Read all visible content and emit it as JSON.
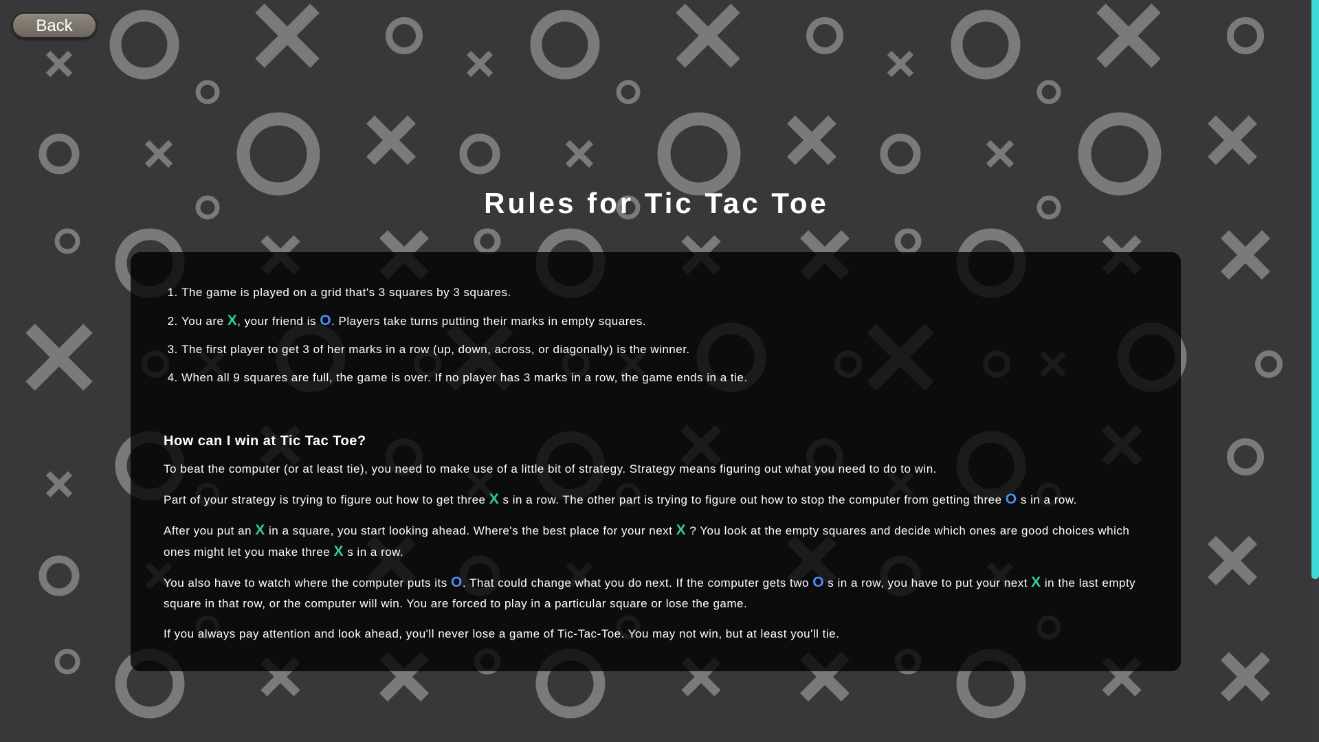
{
  "back_button": {
    "label": "Back"
  },
  "background": {
    "pattern_icons": [
      "x-mark-icon",
      "o-mark-icon"
    ],
    "mark_color": "#7a7a7c"
  },
  "title": "Rules for Tic Tac Toe",
  "marks": {
    "x": "X",
    "o": "O",
    "x_color": "#2fd197",
    "o_color": "#4f8cf7"
  },
  "rules": {
    "r1": {
      "text": "The game is played on a grid that's 3 squares by 3 squares."
    },
    "r2": {
      "a": "You are ",
      "b": ", your friend is ",
      "c": ". Players take turns putting their marks in empty squares."
    },
    "r3": {
      "text": "The first player to get 3 of her marks in a row (up, down, across, or diagonally) is the winner."
    },
    "r4": {
      "text": "When all 9 squares are full, the game is over. If no player has 3 marks in a row, the game ends in a tie."
    }
  },
  "strategy": {
    "heading": "How can I win at Tic Tac Toe?",
    "p1": {
      "text": "To beat the computer (or at least tie), you need to make use of a little bit of strategy. Strategy means figuring out what you need to do to win."
    },
    "p2": {
      "a": "Part of your strategy is trying to figure out how to get three ",
      "b": " s in a row. The other part is trying to figure out how to stop the computer from getting three ",
      "c": " s in a row."
    },
    "p3": {
      "a": "After you put an ",
      "b": " in a square, you start looking ahead. Where's the best place for your next ",
      "c": " ? You look at the empty squares and decide which ones are good choices which ones might let you make three ",
      "d": " s in a row."
    },
    "p4": {
      "a": "You also have to watch where the computer puts its ",
      "b": ". That could change what you do next. If the computer gets two ",
      "c": " s in a row, you have to put your next ",
      "d": " in the last empty square in that row, or the computer will win. You are forced to play in a particular square or lose the game."
    },
    "p5": {
      "text": "If you always pay attention and look ahead, you'll never lose a game of Tic-Tac-Toe. You may not win, but at least you'll tie."
    }
  }
}
